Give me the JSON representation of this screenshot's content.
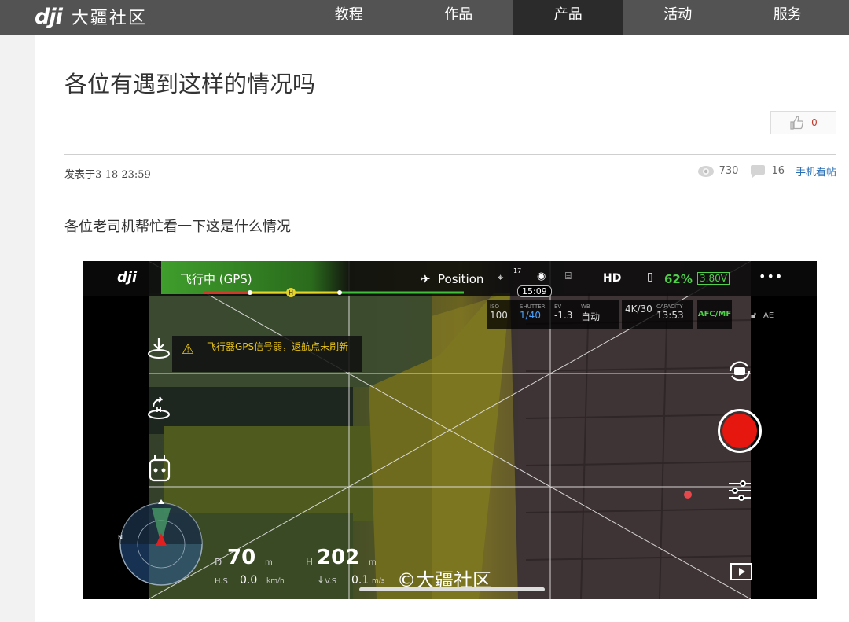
{
  "header": {
    "logo_mark": "dji",
    "logo_text": "大疆社区",
    "nav": [
      {
        "label": "教程",
        "active": false
      },
      {
        "label": "作品",
        "active": false
      },
      {
        "label": "产品",
        "active": true
      },
      {
        "label": "活动",
        "active": false
      },
      {
        "label": "服务",
        "active": false
      }
    ]
  },
  "post": {
    "title": "各位有遇到这样的情况吗",
    "like_count": "0",
    "date": "发表于3-18 23:59",
    "views": "730",
    "replies": "16",
    "mobile_link": "手机看帖",
    "body": "各位老司机帮忙看一下这是什么情况"
  },
  "drone_ui": {
    "logo": "dji",
    "status": "飞行中 (GPS)",
    "mode": "Position",
    "satellites": "17",
    "video": "HD",
    "battery_pct": "62%",
    "battery_volt": "3.80V",
    "more": "•••",
    "timer": "15:09",
    "iso_label": "ISO",
    "iso": "100",
    "shutter_label": "SHUTTER",
    "shutter": "1/40",
    "ev_label": "EV",
    "ev": "-1.3",
    "wb_label": "WB",
    "wb": "自动",
    "res_label": "",
    "res": "4K/30",
    "capacity_label": "CAPACITY",
    "capacity": "13:53",
    "focus": "AFC/MF",
    "ae": "AE",
    "warning": "飞行器GPS信号弱，返航点未刷新",
    "distance_label": "D",
    "distance": "70",
    "distance_unit": "m",
    "height_label": "H",
    "height": "202",
    "height_unit": "m",
    "hs_label": "H.S",
    "hs": "0.0",
    "hs_unit": "km/h",
    "vs_label": "V.S",
    "vs": "0.1",
    "vs_unit": "m/s",
    "watermark": "©大疆社区",
    "north": "N"
  }
}
